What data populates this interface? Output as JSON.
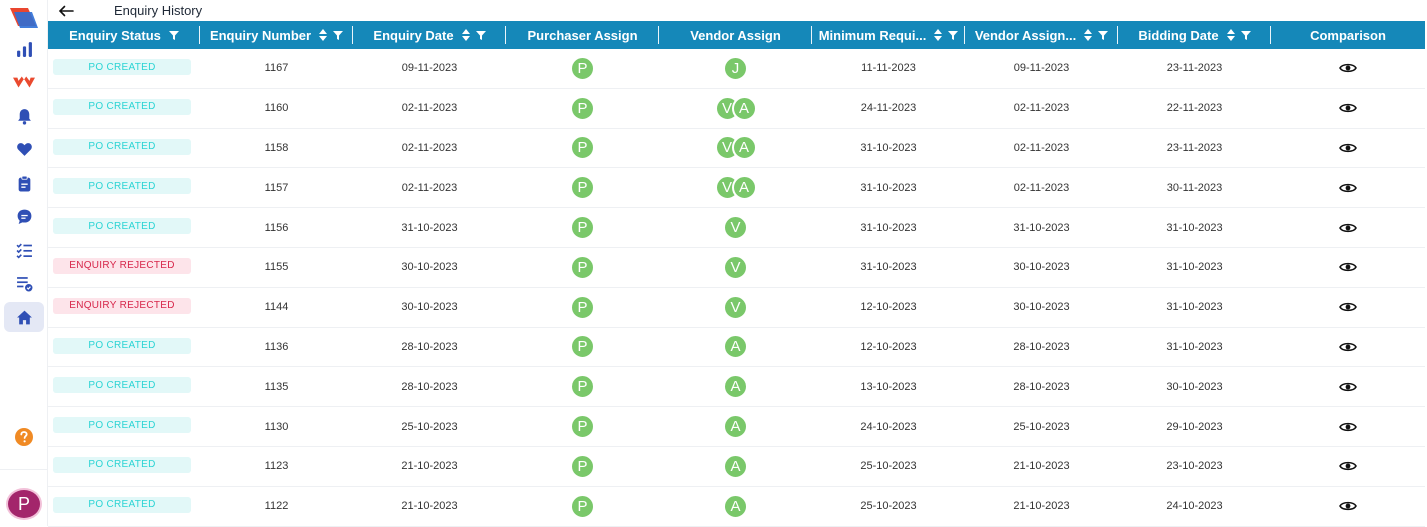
{
  "page": {
    "title": "Enquiry History"
  },
  "sidebar": {
    "items": [
      {
        "name": "analytics-icon"
      },
      {
        "name": "brand-mark-icon"
      },
      {
        "name": "bell-icon"
      },
      {
        "name": "heart-icon"
      },
      {
        "name": "clipboard-icon"
      },
      {
        "name": "chat-icon"
      },
      {
        "name": "checklist-icon"
      },
      {
        "name": "list-check-icon"
      },
      {
        "name": "home-icon",
        "active": true
      }
    ],
    "avatar_initial": "P"
  },
  "columns": [
    "Enquiry Status",
    "Enquiry Number",
    "Enquiry Date",
    "Purchaser Assign",
    "Vendor Assign",
    "Minimum Requi...",
    "Vendor Assign...",
    "Bidding Date",
    "Comparison"
  ],
  "rows": [
    {
      "status": "PO CREATED",
      "status_type": "po",
      "number": "1167",
      "date": "09-11-2023",
      "purchaser": [
        "P"
      ],
      "vendor": [
        "J"
      ],
      "min_req": "11-11-2023",
      "vendor_assign_date": "09-11-2023",
      "bidding": "23-11-2023"
    },
    {
      "status": "PO CREATED",
      "status_type": "po",
      "number": "1160",
      "date": "02-11-2023",
      "purchaser": [
        "P"
      ],
      "vendor": [
        "V",
        "A"
      ],
      "min_req": "24-11-2023",
      "vendor_assign_date": "02-11-2023",
      "bidding": "22-11-2023"
    },
    {
      "status": "PO CREATED",
      "status_type": "po",
      "number": "1158",
      "date": "02-11-2023",
      "purchaser": [
        "P"
      ],
      "vendor": [
        "V",
        "A"
      ],
      "min_req": "31-10-2023",
      "vendor_assign_date": "02-11-2023",
      "bidding": "23-11-2023"
    },
    {
      "status": "PO CREATED",
      "status_type": "po",
      "number": "1157",
      "date": "02-11-2023",
      "purchaser": [
        "P"
      ],
      "vendor": [
        "V",
        "A"
      ],
      "min_req": "31-10-2023",
      "vendor_assign_date": "02-11-2023",
      "bidding": "30-11-2023"
    },
    {
      "status": "PO CREATED",
      "status_type": "po",
      "number": "1156",
      "date": "31-10-2023",
      "purchaser": [
        "P"
      ],
      "vendor": [
        "V"
      ],
      "min_req": "31-10-2023",
      "vendor_assign_date": "31-10-2023",
      "bidding": "31-10-2023"
    },
    {
      "status": "ENQUIRY REJECTED",
      "status_type": "rej",
      "number": "1155",
      "date": "30-10-2023",
      "purchaser": [
        "P"
      ],
      "vendor": [
        "V"
      ],
      "min_req": "31-10-2023",
      "vendor_assign_date": "30-10-2023",
      "bidding": "31-10-2023"
    },
    {
      "status": "ENQUIRY REJECTED",
      "status_type": "rej",
      "number": "1144",
      "date": "30-10-2023",
      "purchaser": [
        "P"
      ],
      "vendor": [
        "V"
      ],
      "min_req": "12-10-2023",
      "vendor_assign_date": "30-10-2023",
      "bidding": "31-10-2023"
    },
    {
      "status": "PO CREATED",
      "status_type": "po",
      "number": "1136",
      "date": "28-10-2023",
      "purchaser": [
        "P"
      ],
      "vendor": [
        "A"
      ],
      "min_req": "12-10-2023",
      "vendor_assign_date": "28-10-2023",
      "bidding": "31-10-2023"
    },
    {
      "status": "PO CREATED",
      "status_type": "po",
      "number": "1135",
      "date": "28-10-2023",
      "purchaser": [
        "P"
      ],
      "vendor": [
        "A"
      ],
      "min_req": "13-10-2023",
      "vendor_assign_date": "28-10-2023",
      "bidding": "30-10-2023"
    },
    {
      "status": "PO CREATED",
      "status_type": "po",
      "number": "1130",
      "date": "25-10-2023",
      "purchaser": [
        "P"
      ],
      "vendor": [
        "A"
      ],
      "min_req": "24-10-2023",
      "vendor_assign_date": "25-10-2023",
      "bidding": "29-10-2023"
    },
    {
      "status": "PO CREATED",
      "status_type": "po",
      "number": "1123",
      "date": "21-10-2023",
      "purchaser": [
        "P"
      ],
      "vendor": [
        "A"
      ],
      "min_req": "25-10-2023",
      "vendor_assign_date": "21-10-2023",
      "bidding": "23-10-2023"
    },
    {
      "status": "PO CREATED",
      "status_type": "po",
      "number": "1122",
      "date": "21-10-2023",
      "purchaser": [
        "P"
      ],
      "vendor": [
        "A"
      ],
      "min_req": "25-10-2023",
      "vendor_assign_date": "21-10-2023",
      "bidding": "24-10-2023"
    }
  ],
  "colors": {
    "header_bg": "#1588b9",
    "po_badge_bg": "#e2f8f8",
    "po_badge_text": "#2bd4d4",
    "rejected_badge_bg": "#fde4ea",
    "rejected_badge_text": "#d7264a",
    "assign_circle": "#7ac86a",
    "avatar_bg": "#a3256b"
  }
}
